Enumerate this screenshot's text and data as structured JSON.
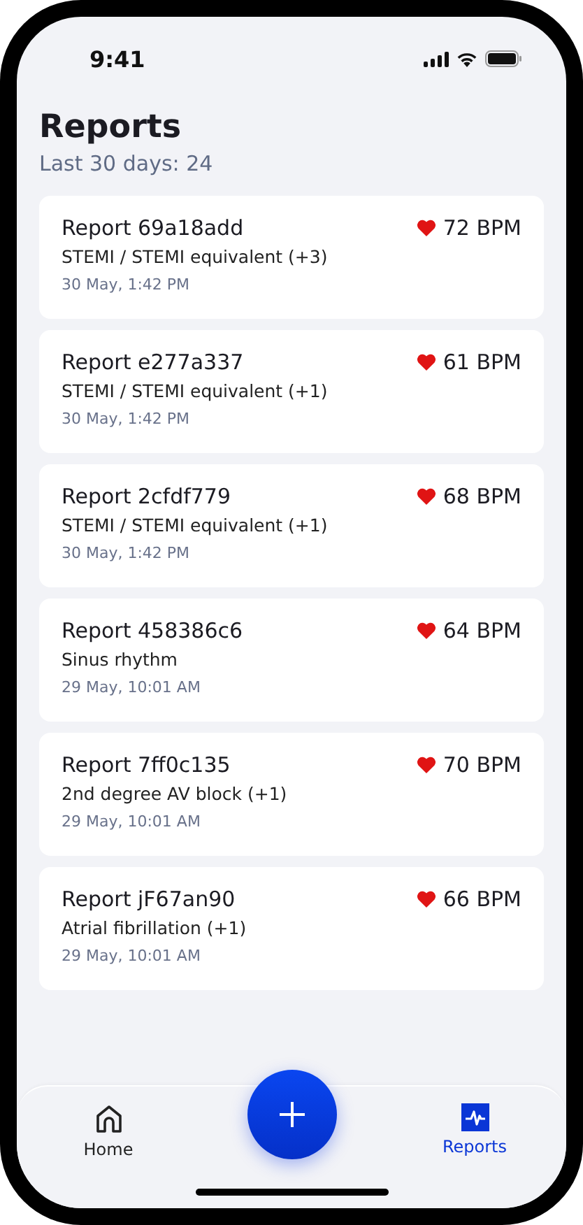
{
  "status_bar": {
    "time": "9:41"
  },
  "header": {
    "title": "Reports",
    "subtitle": "Last 30 days: 24"
  },
  "reports": [
    {
      "title": "Report 69a18add",
      "bpm": "72 BPM",
      "diagnosis": "STEMI / STEMI equivalent (+3)",
      "date": "30 May, 1:42 PM"
    },
    {
      "title": "Report e277a337",
      "bpm": "61 BPM",
      "diagnosis": "STEMI / STEMI equivalent (+1)",
      "date": "30 May, 1:42 PM"
    },
    {
      "title": "Report 2cfdf779",
      "bpm": "68 BPM",
      "diagnosis": "STEMI / STEMI equivalent (+1)",
      "date": "30 May, 1:42 PM"
    },
    {
      "title": "Report 458386c6",
      "bpm": "64 BPM",
      "diagnosis": "Sinus rhythm",
      "date": "29 May, 10:01 AM"
    },
    {
      "title": "Report 7ff0c135",
      "bpm": "70 BPM",
      "diagnosis": "2nd degree AV block (+1)",
      "date": "29 May, 10:01 AM"
    },
    {
      "title": "Report jF67an90",
      "bpm": "66 BPM",
      "diagnosis": "Atrial fibrillation (+1)",
      "date": "29 May, 10:01 AM"
    }
  ],
  "tab_bar": {
    "tabs": [
      {
        "kind": "home",
        "label": "Home",
        "selected": false
      },
      {
        "kind": "reports",
        "label": "Reports",
        "selected": true
      }
    ]
  }
}
